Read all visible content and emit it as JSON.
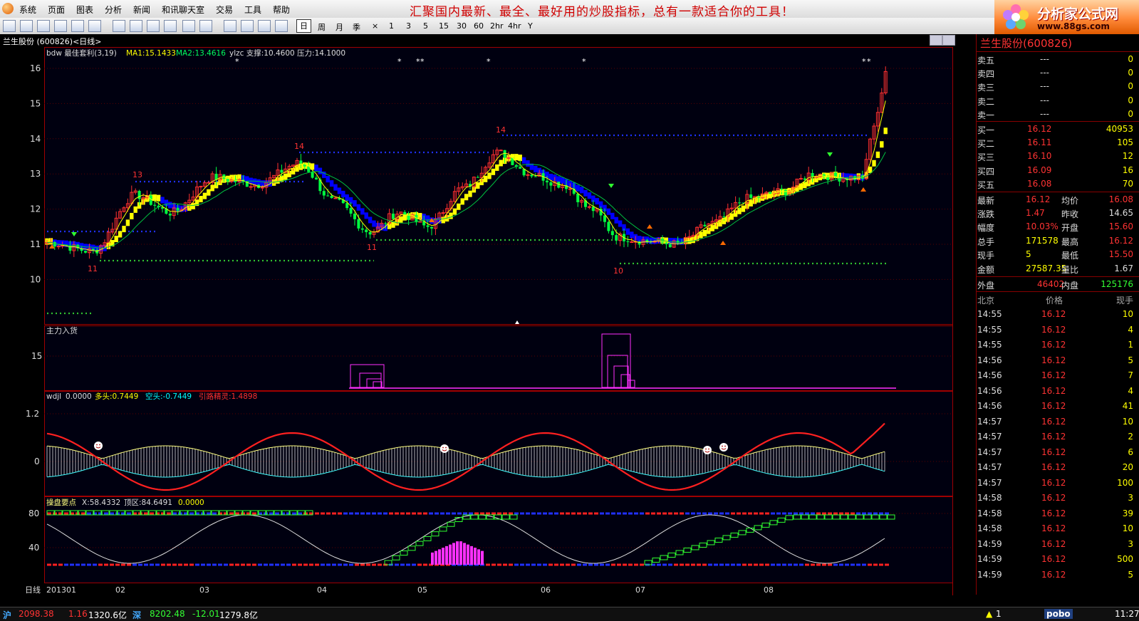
{
  "menu": [
    "系统",
    "页面",
    "图表",
    "分析",
    "新闻",
    "和讯聊天室",
    "交易",
    "工具",
    "帮助"
  ],
  "slogan": "汇聚国内最新、最全、最好用的炒股指标，总有一款适合你的工具！",
  "brand": {
    "name": "分析家公式网",
    "url": "www.88gs.com"
  },
  "periods": [
    "日",
    "周",
    "月",
    "季",
    "×",
    "1",
    "3",
    "5",
    "15",
    "30",
    "60",
    "2hr",
    "4hr",
    "Y"
  ],
  "active_period": "日",
  "chart_title": "兰生股份 (600826)<日线>",
  "main_chart": {
    "legend_prefix": "bdw  最佳套利(3,19)",
    "ma1": "MA1:15.1433",
    "ma2": "MA2:13.4616",
    "ylzc": "ylzc 支撑:10.4600 压力:14.1000",
    "y_ticks": [
      "16",
      "15",
      "14",
      "13",
      "12",
      "11",
      "10"
    ],
    "marks": [
      {
        "text": "13",
        "color": "#f33"
      },
      {
        "text": "14",
        "color": "#f33"
      },
      {
        "text": "14",
        "color": "#f33"
      },
      {
        "text": "11",
        "color": "#f33"
      },
      {
        "text": "11",
        "color": "#f33"
      },
      {
        "text": "10",
        "color": "#f33"
      }
    ]
  },
  "panel2": {
    "label": "主力入货",
    "y_tick": "15"
  },
  "panel3": {
    "label": "wdjl",
    "val": "0.0000",
    "duo": "多头:0.7449",
    "kong": "空头:-0.7449",
    "jl": "引路精灵:1.4898",
    "y_ticks": [
      "1.2",
      "0"
    ]
  },
  "panel4": {
    "label": "操盘要点",
    "x": "X:58.4332",
    "top": "顶区:84.6491",
    "val": "0.0000",
    "y_ticks": [
      "80",
      "40"
    ]
  },
  "x_axis": {
    "label": "日线",
    "ticks": [
      "201301",
      "02",
      "03",
      "04",
      "05",
      "06",
      "07",
      "08"
    ]
  },
  "quote": {
    "title": "兰生股份(600826)",
    "sell": [
      {
        "label": "卖五",
        "price": "---",
        "vol": "0"
      },
      {
        "label": "卖四",
        "price": "---",
        "vol": "0"
      },
      {
        "label": "卖三",
        "price": "---",
        "vol": "0"
      },
      {
        "label": "卖二",
        "price": "---",
        "vol": "0"
      },
      {
        "label": "卖一",
        "price": "---",
        "vol": "0"
      }
    ],
    "buy": [
      {
        "label": "买一",
        "price": "16.12",
        "vol": "40953"
      },
      {
        "label": "买二",
        "price": "16.11",
        "vol": "105"
      },
      {
        "label": "买三",
        "price": "16.10",
        "vol": "12"
      },
      {
        "label": "买四",
        "price": "16.09",
        "vol": "16"
      },
      {
        "label": "买五",
        "price": "16.08",
        "vol": "70"
      }
    ],
    "stats": [
      {
        "l1": "最新",
        "v1": "16.12",
        "l2": "均价",
        "v2": "16.08"
      },
      {
        "l1": "涨跌",
        "v1": "1.47",
        "l2": "昨收",
        "v2": "14.65"
      },
      {
        "l1": "幅度",
        "v1": "10.03%",
        "l2": "开盘",
        "v2": "15.60"
      },
      {
        "l1": "总手",
        "v1": "171578",
        "l2": "最高",
        "v2": "16.12"
      },
      {
        "l1": "现手",
        "v1": "5",
        "l2": "最低",
        "v2": "15.50"
      },
      {
        "l1": "金额",
        "v1": "27587.35",
        "l2": "量比",
        "v2": "1.67"
      }
    ],
    "outer": {
      "l1": "外盘",
      "v1": "46402",
      "l2": "内盘",
      "v2": "125176"
    },
    "tick_header": [
      "北京",
      "价格",
      "现手"
    ],
    "ticks": [
      [
        "14:55",
        "16.12",
        "10"
      ],
      [
        "14:55",
        "16.12",
        "4"
      ],
      [
        "14:55",
        "16.12",
        "1"
      ],
      [
        "14:56",
        "16.12",
        "5"
      ],
      [
        "14:56",
        "16.12",
        "7"
      ],
      [
        "14:56",
        "16.12",
        "4"
      ],
      [
        "14:56",
        "16.12",
        "41"
      ],
      [
        "14:57",
        "16.12",
        "10"
      ],
      [
        "14:57",
        "16.12",
        "2"
      ],
      [
        "14:57",
        "16.12",
        "6"
      ],
      [
        "14:57",
        "16.12",
        "20"
      ],
      [
        "14:57",
        "16.12",
        "100"
      ],
      [
        "14:58",
        "16.12",
        "3"
      ],
      [
        "14:58",
        "16.12",
        "39"
      ],
      [
        "14:58",
        "16.12",
        "10"
      ],
      [
        "14:59",
        "16.12",
        "3"
      ],
      [
        "14:59",
        "16.12",
        "500"
      ],
      [
        "14:59",
        "16.12",
        "5"
      ]
    ]
  },
  "status": {
    "sh_label": "沪",
    "sh_idx": "2098.38",
    "sh_chg": "1.16",
    "sh_amt": "1320.6亿",
    "sz_label": "深",
    "sz_idx": "8202.48",
    "sz_chg": "-12.01",
    "sz_amt": "1279.8亿",
    "alert": "1",
    "pobo": "pobo",
    "time": "11:27"
  },
  "colors": {
    "up": "#ff3030",
    "down": "#00ff40",
    "yellow": "#ffff00",
    "blue": "#0000ff",
    "magenta": "#ff00ff",
    "grid": "#800000"
  }
}
